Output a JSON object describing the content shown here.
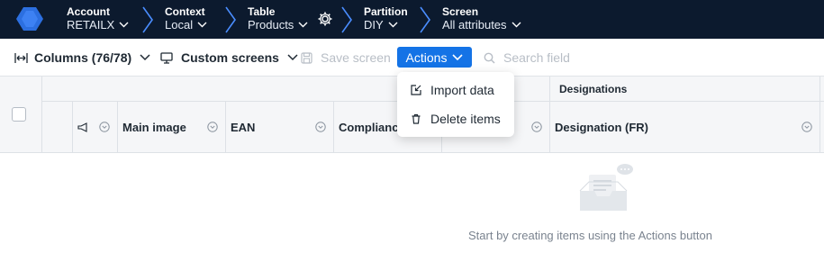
{
  "nav": {
    "account": {
      "label": "Account",
      "value": "RETAILX"
    },
    "context": {
      "label": "Context",
      "value": "Local"
    },
    "table": {
      "label": "Table",
      "value": "Products"
    },
    "partition": {
      "label": "Partition",
      "value": "DIY"
    },
    "screen": {
      "label": "Screen",
      "value": "All attributes"
    }
  },
  "toolbar": {
    "columns_label": "Columns (76/78)",
    "custom_screens_label": "Custom screens",
    "save_screen_label": "Save screen",
    "actions_label": "Actions",
    "search_placeholder": "Search field"
  },
  "actions_menu": {
    "items": [
      {
        "label": "Import data",
        "icon": "import-icon"
      },
      {
        "label": "Delete items",
        "icon": "trash-icon"
      }
    ]
  },
  "table": {
    "group_header": "Designations",
    "columns": [
      "Main image",
      "EAN",
      "Compliance",
      "Designation (FR)"
    ]
  },
  "empty_state": {
    "message": "Start by creating items using the Actions button"
  },
  "colors": {
    "nav_bg": "#0c1a2e",
    "accent": "#1473e6",
    "logo": "#2c6fe0"
  }
}
